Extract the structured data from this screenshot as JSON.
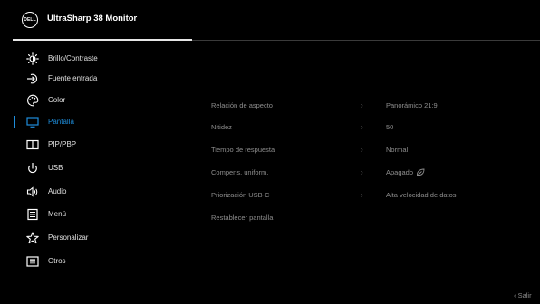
{
  "header": {
    "logo_text": "DELL",
    "title": "UltraSharp 38 Monitor"
  },
  "menu": [
    {
      "label": "Brillo/Contraste",
      "icon": "brightness-icon"
    },
    {
      "label": "Fuente entrada",
      "icon": "input-source-icon"
    },
    {
      "label": "Color",
      "icon": "color-palette-icon"
    },
    {
      "label": "Pantalla",
      "icon": "display-monitor-icon",
      "active": true
    },
    {
      "label": "PIP/PBP",
      "icon": "pip-pbp-icon"
    },
    {
      "label": "USB",
      "icon": "usb-power-icon"
    },
    {
      "label": "Audio",
      "icon": "speaker-icon"
    },
    {
      "label": "Menú",
      "icon": "menu-list-icon"
    },
    {
      "label": "Personalizar",
      "icon": "star-icon"
    },
    {
      "label": "Otros",
      "icon": "others-icon"
    }
  ],
  "display_settings": [
    {
      "name": "Relación de aspecto",
      "chevron": "›",
      "value": "Panorámico 21:9"
    },
    {
      "name": "Nitidez",
      "chevron": "›",
      "value": "50"
    },
    {
      "name": "Tiempo de respuesta",
      "chevron": "›",
      "value": "Normal"
    },
    {
      "name": "Compens. uniform.",
      "chevron": "›",
      "value": "Apagado",
      "value_icon": "energy-leaf-icon"
    },
    {
      "name": "Priorización USB-C",
      "chevron": "›",
      "value": "Alta velocidad de datos"
    },
    {
      "name": "Restablecer pantalla"
    }
  ],
  "footer": {
    "exit_label": "‹  Salir"
  },
  "colors": {
    "accent": "#1e8ddb",
    "muted_text": "#8e8e8e",
    "background": "#000000"
  }
}
